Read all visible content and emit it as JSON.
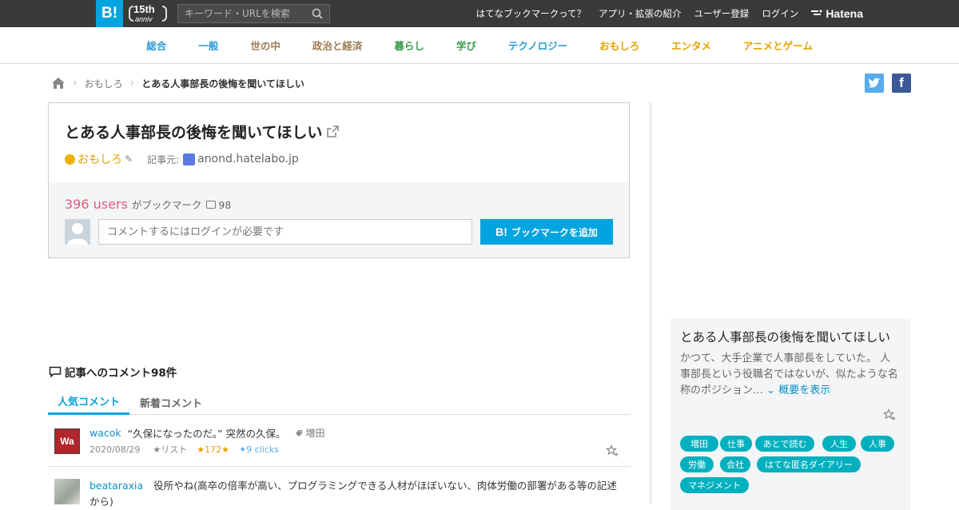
{
  "header": {
    "logo": "B!",
    "anniv_number": "15th",
    "anniv_text": "anniv",
    "search_placeholder": "キーワード・URLを検索",
    "nav": [
      "はてなブックマークって？",
      "アプリ・拡張の紹介",
      "ユーザー登録",
      "ログイン"
    ],
    "hatena": "Hatena"
  },
  "categories": [
    {
      "label": "総合",
      "color": "#2b9bd4"
    },
    {
      "label": "一般",
      "color": "#2b9bd4"
    },
    {
      "label": "世の中",
      "color": "#9c7b52"
    },
    {
      "label": "政治と経済",
      "color": "#9c7b52"
    },
    {
      "label": "暮らし",
      "color": "#3d9b4e"
    },
    {
      "label": "学び",
      "color": "#3d9b4e"
    },
    {
      "label": "テクノロジー",
      "color": "#2b9bd4"
    },
    {
      "label": "おもしろ",
      "color": "#e8a000"
    },
    {
      "label": "エンタメ",
      "color": "#e8a000"
    },
    {
      "label": "アニメとゲーム",
      "color": "#e8a000"
    }
  ],
  "breadcrumb": {
    "category": "おもしろ",
    "current": "とある人事部長の後悔を聞いてほしい"
  },
  "share": {
    "twitter": "t",
    "facebook": "f"
  },
  "entry": {
    "title": "とある人事部長の後悔を聞いてほしい",
    "category": "おもしろ",
    "source_label": "記事元:",
    "domain": "anond.hatelabo.jp",
    "users_count": "396 users",
    "users_label": "がブックマーク",
    "comment_count": "98",
    "comment_placeholder": "コメントするにはログインが必要です",
    "add_button": "ブックマークを追加",
    "add_button_icon": "B!"
  },
  "comments": {
    "heading": "記事へのコメント98件",
    "tabs": [
      "人気コメント",
      "新着コメント"
    ],
    "items": [
      {
        "user": "wacok",
        "avatar_text": "Wa",
        "text": "“久保になったのだ。” 突然の久保。",
        "tag": "増田",
        "date": "2020/08/29",
        "list": "リスト",
        "stars": "172",
        "clicks": "9 clicks"
      },
      {
        "user": "beataraxia",
        "text": "役所やね(高卒の倍率が高い、プログラミングできる人材がほぼいない、肉体労働の部署がある等の記述から)"
      }
    ]
  },
  "sidebar": {
    "title": "とある人事部長の後悔を聞いてほしい",
    "summary": "かつて、大手企業で人事部長をしていた。 人事部長という役職名ではないが、似たような名称のポジション…",
    "more": "概要を表示",
    "tags": [
      "増田",
      "仕事",
      "あとで読む",
      "人生",
      "人事",
      "労働",
      "会社",
      "はてな匿名ダイアリー",
      "マネジメント"
    ]
  }
}
